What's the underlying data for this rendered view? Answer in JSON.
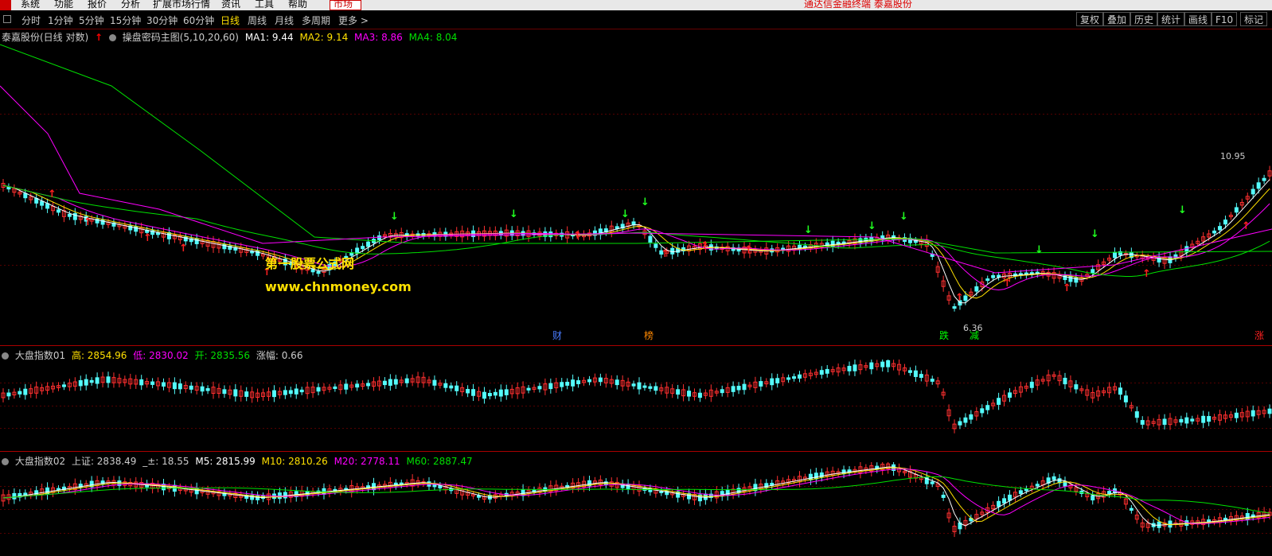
{
  "menubar": {
    "items": [
      "系统",
      "功能",
      "报价",
      "分析",
      "扩展市场行情",
      "资讯",
      "工具",
      "帮助"
    ],
    "market": "市场",
    "title": "通达信金融终端  泰嘉股份"
  },
  "toolbar": {
    "periods": [
      "分时",
      "1分钟",
      "5分钟",
      "15分钟",
      "30分钟",
      "60分钟",
      "日线",
      "周线",
      "月线",
      "多周期",
      "更多 >"
    ],
    "active_period": "日线",
    "right_buttons": [
      "复权",
      "叠加",
      "历史",
      "统计",
      "画线",
      "F10",
      "标记"
    ]
  },
  "main_panel": {
    "stock_name": "泰嘉股份(日线 对数)",
    "indicator": "操盘密码主图(5,10,20,60)",
    "ma": [
      {
        "label": "MA1: 9.44",
        "color": "#ffffff"
      },
      {
        "label": "MA2: 9.14",
        "color": "#ffe000"
      },
      {
        "label": "MA3: 8.86",
        "color": "#ff00ff"
      },
      {
        "label": "MA4: 8.04",
        "color": "#00e000"
      }
    ],
    "high_label": "10.95",
    "low_label": "6.36",
    "tags": [
      {
        "text": "财",
        "color": "#4a7cff"
      },
      {
        "text": "榜",
        "color": "#ff8800"
      },
      {
        "text": "跌",
        "color": "#00ff00"
      },
      {
        "text": "减",
        "color": "#00ff00"
      },
      {
        "text": "涨",
        "color": "#ff2020"
      }
    ]
  },
  "watermark": {
    "line1": "第一股票公式网",
    "line2": "www.chnmoney.com"
  },
  "panel2": {
    "title": "大盘指数01",
    "values": [
      {
        "label": "高: 2854.96",
        "color": "#ffe000"
      },
      {
        "label": "低: 2830.02",
        "color": "#ff00ff"
      },
      {
        "label": "开: 2835.56",
        "color": "#00e000"
      },
      {
        "label": "涨幅: 0.66",
        "color": "#cccccc"
      }
    ]
  },
  "panel3": {
    "title": "大盘指数02",
    "values": [
      {
        "label": "上证: 2838.49",
        "color": "#cccccc"
      },
      {
        "label": "_±: 18.55",
        "color": "#cccccc"
      },
      {
        "label": "M5: 2815.99",
        "color": "#ffffff"
      },
      {
        "label": "M10: 2810.26",
        "color": "#ffe000"
      },
      {
        "label": "M20: 2778.11",
        "color": "#ff00ff"
      },
      {
        "label": "M60: 2887.47",
        "color": "#00e000"
      }
    ]
  },
  "colors": {
    "up": "#ff3030",
    "down": "#54fcfc",
    "separator": "#aa0000",
    "ma5": "#ffffff",
    "ma10": "#ffe000",
    "ma20": "#ff00ff",
    "ma60": "#00e000"
  }
}
